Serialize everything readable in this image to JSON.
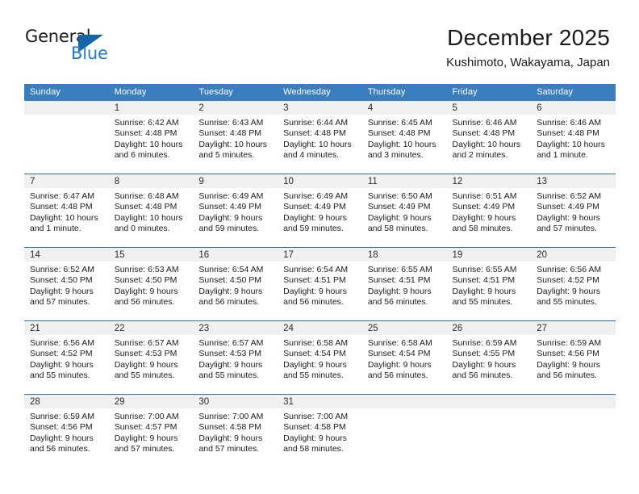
{
  "brand": {
    "name_top": "General",
    "name_bottom": "Blue",
    "accent_color": "#1f7cc4",
    "triangle_color": "#1565a8",
    "triangle_icon": "triangle-icon"
  },
  "header": {
    "title": "December 2025",
    "subtitle": "Kushimoto, Wakayama, Japan"
  },
  "theme": {
    "header_bar_color": "#3a7ebf",
    "week_divider_color": "#2f6ea8",
    "daynum_band_color": "#f0f0f0",
    "text_color": "#1b1b1b"
  },
  "weekdays": [
    "Sunday",
    "Monday",
    "Tuesday",
    "Wednesday",
    "Thursday",
    "Friday",
    "Saturday"
  ],
  "weeks": [
    [
      {
        "day": "",
        "sunrise": "",
        "sunset": "",
        "daylight_line1": "",
        "daylight_line2": ""
      },
      {
        "day": "1",
        "sunrise": "Sunrise: 6:42 AM",
        "sunset": "Sunset: 4:48 PM",
        "daylight_line1": "Daylight: 10 hours",
        "daylight_line2": "and 6 minutes."
      },
      {
        "day": "2",
        "sunrise": "Sunrise: 6:43 AM",
        "sunset": "Sunset: 4:48 PM",
        "daylight_line1": "Daylight: 10 hours",
        "daylight_line2": "and 5 minutes."
      },
      {
        "day": "3",
        "sunrise": "Sunrise: 6:44 AM",
        "sunset": "Sunset: 4:48 PM",
        "daylight_line1": "Daylight: 10 hours",
        "daylight_line2": "and 4 minutes."
      },
      {
        "day": "4",
        "sunrise": "Sunrise: 6:45 AM",
        "sunset": "Sunset: 4:48 PM",
        "daylight_line1": "Daylight: 10 hours",
        "daylight_line2": "and 3 minutes."
      },
      {
        "day": "5",
        "sunrise": "Sunrise: 6:46 AM",
        "sunset": "Sunset: 4:48 PM",
        "daylight_line1": "Daylight: 10 hours",
        "daylight_line2": "and 2 minutes."
      },
      {
        "day": "6",
        "sunrise": "Sunrise: 6:46 AM",
        "sunset": "Sunset: 4:48 PM",
        "daylight_line1": "Daylight: 10 hours",
        "daylight_line2": "and 1 minute."
      }
    ],
    [
      {
        "day": "7",
        "sunrise": "Sunrise: 6:47 AM",
        "sunset": "Sunset: 4:48 PM",
        "daylight_line1": "Daylight: 10 hours",
        "daylight_line2": "and 1 minute."
      },
      {
        "day": "8",
        "sunrise": "Sunrise: 6:48 AM",
        "sunset": "Sunset: 4:48 PM",
        "daylight_line1": "Daylight: 10 hours",
        "daylight_line2": "and 0 minutes."
      },
      {
        "day": "9",
        "sunrise": "Sunrise: 6:49 AM",
        "sunset": "Sunset: 4:49 PM",
        "daylight_line1": "Daylight: 9 hours",
        "daylight_line2": "and 59 minutes."
      },
      {
        "day": "10",
        "sunrise": "Sunrise: 6:49 AM",
        "sunset": "Sunset: 4:49 PM",
        "daylight_line1": "Daylight: 9 hours",
        "daylight_line2": "and 59 minutes."
      },
      {
        "day": "11",
        "sunrise": "Sunrise: 6:50 AM",
        "sunset": "Sunset: 4:49 PM",
        "daylight_line1": "Daylight: 9 hours",
        "daylight_line2": "and 58 minutes."
      },
      {
        "day": "12",
        "sunrise": "Sunrise: 6:51 AM",
        "sunset": "Sunset: 4:49 PM",
        "daylight_line1": "Daylight: 9 hours",
        "daylight_line2": "and 58 minutes."
      },
      {
        "day": "13",
        "sunrise": "Sunrise: 6:52 AM",
        "sunset": "Sunset: 4:49 PM",
        "daylight_line1": "Daylight: 9 hours",
        "daylight_line2": "and 57 minutes."
      }
    ],
    [
      {
        "day": "14",
        "sunrise": "Sunrise: 6:52 AM",
        "sunset": "Sunset: 4:50 PM",
        "daylight_line1": "Daylight: 9 hours",
        "daylight_line2": "and 57 minutes."
      },
      {
        "day": "15",
        "sunrise": "Sunrise: 6:53 AM",
        "sunset": "Sunset: 4:50 PM",
        "daylight_line1": "Daylight: 9 hours",
        "daylight_line2": "and 56 minutes."
      },
      {
        "day": "16",
        "sunrise": "Sunrise: 6:54 AM",
        "sunset": "Sunset: 4:50 PM",
        "daylight_line1": "Daylight: 9 hours",
        "daylight_line2": "and 56 minutes."
      },
      {
        "day": "17",
        "sunrise": "Sunrise: 6:54 AM",
        "sunset": "Sunset: 4:51 PM",
        "daylight_line1": "Daylight: 9 hours",
        "daylight_line2": "and 56 minutes."
      },
      {
        "day": "18",
        "sunrise": "Sunrise: 6:55 AM",
        "sunset": "Sunset: 4:51 PM",
        "daylight_line1": "Daylight: 9 hours",
        "daylight_line2": "and 56 minutes."
      },
      {
        "day": "19",
        "sunrise": "Sunrise: 6:55 AM",
        "sunset": "Sunset: 4:51 PM",
        "daylight_line1": "Daylight: 9 hours",
        "daylight_line2": "and 55 minutes."
      },
      {
        "day": "20",
        "sunrise": "Sunrise: 6:56 AM",
        "sunset": "Sunset: 4:52 PM",
        "daylight_line1": "Daylight: 9 hours",
        "daylight_line2": "and 55 minutes."
      }
    ],
    [
      {
        "day": "21",
        "sunrise": "Sunrise: 6:56 AM",
        "sunset": "Sunset: 4:52 PM",
        "daylight_line1": "Daylight: 9 hours",
        "daylight_line2": "and 55 minutes."
      },
      {
        "day": "22",
        "sunrise": "Sunrise: 6:57 AM",
        "sunset": "Sunset: 4:53 PM",
        "daylight_line1": "Daylight: 9 hours",
        "daylight_line2": "and 55 minutes."
      },
      {
        "day": "23",
        "sunrise": "Sunrise: 6:57 AM",
        "sunset": "Sunset: 4:53 PM",
        "daylight_line1": "Daylight: 9 hours",
        "daylight_line2": "and 55 minutes."
      },
      {
        "day": "24",
        "sunrise": "Sunrise: 6:58 AM",
        "sunset": "Sunset: 4:54 PM",
        "daylight_line1": "Daylight: 9 hours",
        "daylight_line2": "and 55 minutes."
      },
      {
        "day": "25",
        "sunrise": "Sunrise: 6:58 AM",
        "sunset": "Sunset: 4:54 PM",
        "daylight_line1": "Daylight: 9 hours",
        "daylight_line2": "and 56 minutes."
      },
      {
        "day": "26",
        "sunrise": "Sunrise: 6:59 AM",
        "sunset": "Sunset: 4:55 PM",
        "daylight_line1": "Daylight: 9 hours",
        "daylight_line2": "and 56 minutes."
      },
      {
        "day": "27",
        "sunrise": "Sunrise: 6:59 AM",
        "sunset": "Sunset: 4:56 PM",
        "daylight_line1": "Daylight: 9 hours",
        "daylight_line2": "and 56 minutes."
      }
    ],
    [
      {
        "day": "28",
        "sunrise": "Sunrise: 6:59 AM",
        "sunset": "Sunset: 4:56 PM",
        "daylight_line1": "Daylight: 9 hours",
        "daylight_line2": "and 56 minutes."
      },
      {
        "day": "29",
        "sunrise": "Sunrise: 7:00 AM",
        "sunset": "Sunset: 4:57 PM",
        "daylight_line1": "Daylight: 9 hours",
        "daylight_line2": "and 57 minutes."
      },
      {
        "day": "30",
        "sunrise": "Sunrise: 7:00 AM",
        "sunset": "Sunset: 4:58 PM",
        "daylight_line1": "Daylight: 9 hours",
        "daylight_line2": "and 57 minutes."
      },
      {
        "day": "31",
        "sunrise": "Sunrise: 7:00 AM",
        "sunset": "Sunset: 4:58 PM",
        "daylight_line1": "Daylight: 9 hours",
        "daylight_line2": "and 58 minutes."
      },
      {
        "day": "",
        "sunrise": "",
        "sunset": "",
        "daylight_line1": "",
        "daylight_line2": ""
      },
      {
        "day": "",
        "sunrise": "",
        "sunset": "",
        "daylight_line1": "",
        "daylight_line2": ""
      },
      {
        "day": "",
        "sunrise": "",
        "sunset": "",
        "daylight_line1": "",
        "daylight_line2": ""
      }
    ]
  ]
}
